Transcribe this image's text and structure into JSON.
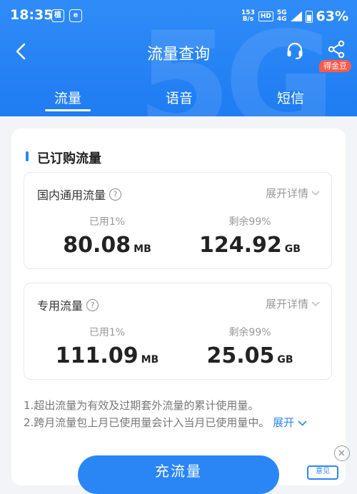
{
  "status_bar": {
    "time": "18:35",
    "app_icons": [
      "植",
      "e"
    ],
    "net_speed_value": "153",
    "net_speed_unit": "B/s",
    "hd": "HD",
    "network_top": "5G",
    "network_bottom": "4G",
    "battery": "63%"
  },
  "nav": {
    "title": "流量查询",
    "badge": "得金豆",
    "icons": [
      "back-icon",
      "headset-icon",
      "share-icon"
    ]
  },
  "tabs": [
    {
      "label": "流量",
      "active": true
    },
    {
      "label": "语音",
      "active": false
    },
    {
      "label": "短信",
      "active": false
    }
  ],
  "section": {
    "title": "已订购流量"
  },
  "plans": [
    {
      "name": "国内通用流量",
      "detail": "展开详情",
      "used_label": "已用1%",
      "used_value": "80.08",
      "used_unit": "MB",
      "remaining_label": "剩余99%",
      "remaining_value": "124.92",
      "remaining_unit": "GB"
    },
    {
      "name": "专用流量",
      "detail": "展开详情",
      "used_label": "已用1%",
      "used_value": "111.09",
      "used_unit": "MB",
      "remaining_label": "剩余99%",
      "remaining_value": "25.05",
      "remaining_unit": "GB"
    }
  ],
  "notes": {
    "line1": "1.超出流量为有效及过期套外流量的累计使用量。",
    "line2": "2.跨月流量包上月已使用量会计入当月已使用量中。",
    "expand": "展开"
  },
  "cta": {
    "label": "充流量"
  },
  "float_widget": {
    "label": "意见"
  },
  "colors": {
    "header": "#2f8cf7",
    "accent": "#2a86f5",
    "badge": "#ff5a4a",
    "background": "#f2f4f7"
  }
}
